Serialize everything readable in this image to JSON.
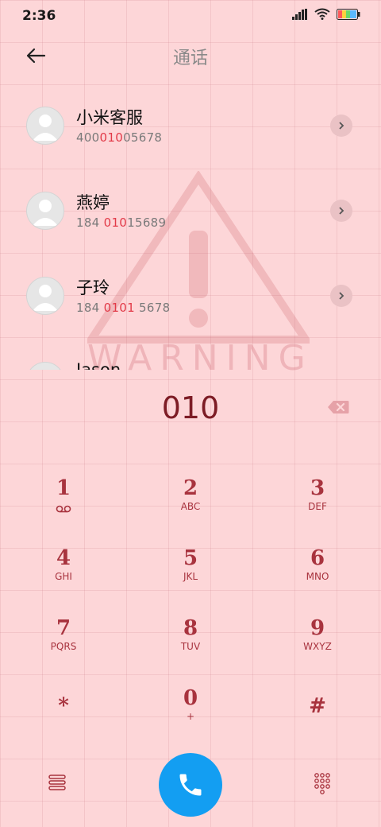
{
  "status": {
    "time": "2:36"
  },
  "header": {
    "title": "通话"
  },
  "contacts": [
    {
      "name": "小米客服",
      "num_pre": "400",
      "num_hl": "010",
      "num_post": "05678"
    },
    {
      "name": "燕婷",
      "num_pre": "184 ",
      "num_hl": "010",
      "num_post": "15689"
    },
    {
      "name": "子玲",
      "num_pre": "184 ",
      "num_hl": "0101",
      "num_post": " 5678"
    },
    {
      "name": "Jason",
      "num_pre": "",
      "num_hl": "",
      "num_post": ""
    }
  ],
  "dial": {
    "digits": "010"
  },
  "keypad": [
    {
      "digit": "1",
      "letters": ""
    },
    {
      "digit": "2",
      "letters": "ABC"
    },
    {
      "digit": "3",
      "letters": "DEF"
    },
    {
      "digit": "4",
      "letters": "GHI"
    },
    {
      "digit": "5",
      "letters": "JKL"
    },
    {
      "digit": "6",
      "letters": "MNO"
    },
    {
      "digit": "7",
      "letters": "PQRS"
    },
    {
      "digit": "8",
      "letters": "TUV"
    },
    {
      "digit": "9",
      "letters": "WXYZ"
    },
    {
      "digit": "*",
      "letters": ""
    },
    {
      "digit": "0",
      "letters": "+"
    },
    {
      "digit": "#",
      "letters": ""
    }
  ],
  "watermark": {
    "text": "WARNING"
  },
  "colors": {
    "call_button": "#139ef2",
    "highlight": "#e23a48",
    "key": "#a8333e"
  }
}
